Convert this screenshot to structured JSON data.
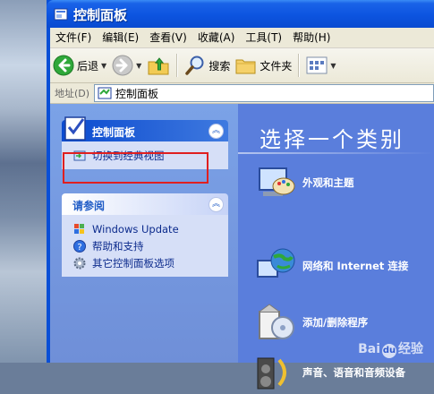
{
  "window": {
    "title": "控制面板"
  },
  "menu": [
    "文件(F)",
    "编辑(E)",
    "查看(V)",
    "收藏(A)",
    "工具(T)",
    "帮助(H)"
  ],
  "toolbar": {
    "back": "后退",
    "search": "搜索",
    "folders": "文件夹"
  },
  "address": {
    "label": "地址(D)",
    "value": "控制面板"
  },
  "left_panels": {
    "control_panel": {
      "title": "控制面板",
      "links": [
        "切换到经典视图"
      ]
    },
    "see_also": {
      "title": "请参阅",
      "links": [
        "Windows Update",
        "帮助和支持",
        "其它控制面板选项"
      ]
    }
  },
  "main": {
    "heading": "选择一个类别",
    "categories": [
      {
        "label": "外观和主题",
        "icon": "appearance-themes-icon"
      },
      {
        "label": "网络和 Internet 连接",
        "icon": "network-internet-icon"
      },
      {
        "label": "添加/删除程序",
        "icon": "add-remove-programs-icon"
      },
      {
        "label": "声音、语音和音频设备",
        "icon": "sounds-audio-icon"
      }
    ]
  },
  "watermark": {
    "text": "Bai",
    "text2": "经验"
  },
  "colors": {
    "titlebar": "#0c54e0",
    "left_pane": "#7ba2e7",
    "right_pane": "#5a7edc",
    "highlight": "#e01f1f"
  }
}
